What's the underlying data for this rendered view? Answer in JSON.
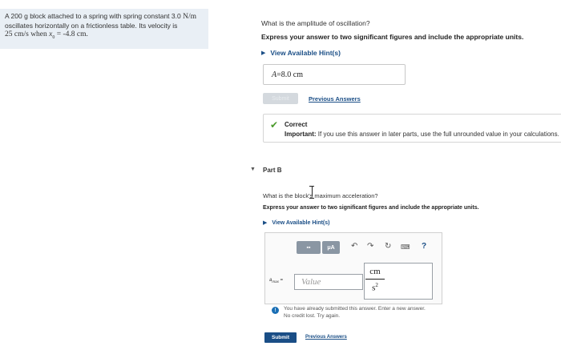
{
  "problem": {
    "line1_a": "A 200 g block attached to a spring with spring constant 3.0 ",
    "line1_unit": "N/m",
    "line2": "oscillates horizontally on a frictionless table. Its velocity is",
    "line3_a": "25 cm/s when ",
    "line3_var": "x",
    "line3_sub": "0",
    "line3_b": " = -4.8 cm."
  },
  "partA": {
    "question": "What is the amplitude of oscillation?",
    "instructions": "Express your answer to two significant figures and include the appropriate units.",
    "hints_label": "View Available Hint(s)",
    "answer_var": "A",
    "answer_eq": " = ",
    "answer_value": "8.0 cm",
    "submit_label": "Submit",
    "previous_answers": "Previous Answers",
    "feedback_status": "Correct",
    "feedback_important_label": "Important:",
    "feedback_important_text": " If you use this answer in later parts, use the full unrounded value in your calculations."
  },
  "partB": {
    "label": "Part B",
    "question": "What is the block's maximum acceleration?",
    "instructions": "Express your answer to two significant figures and include the appropriate units.",
    "hints_label": "View Available Hint(s)",
    "toolbar_templates_label": "▪▪",
    "toolbar_mu_label": "μA",
    "amax_label": "a",
    "amax_sub": "max",
    "amax_eq": " =",
    "value_placeholder": "Value",
    "unit_numerator": "cm",
    "unit_denominator": "s",
    "unit_power": "2",
    "help_label": "?",
    "info_line1": "You have already submitted this answer. Enter a new answer.",
    "info_line2": "No credit lost. Try again.",
    "submit_label": "Submit",
    "previous_answers": "Previous Answers"
  },
  "colors": {
    "link": "#1a4e86",
    "correct_check": "#4a9a2b",
    "problem_bg": "#e9eff5",
    "toolbar_btn": "#8a96a3"
  }
}
